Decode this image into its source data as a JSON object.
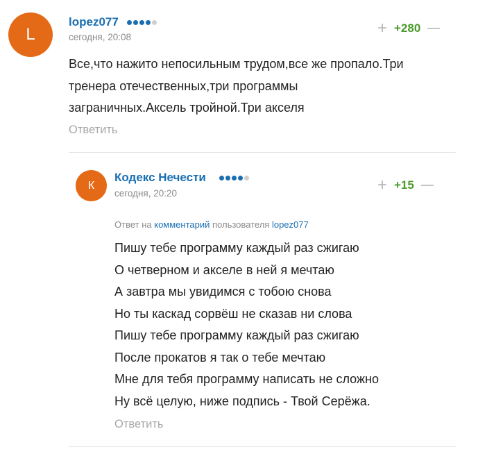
{
  "comments": [
    {
      "avatar_letter": "L",
      "username": "lopez077",
      "timestamp": "сегодня, 20:08",
      "vote": {
        "plus": "+",
        "score": "+280"
      },
      "text_lines": [
        "Все,что нажито непосильным трудом,все же пропало.Три",
        "тренера отечественных,три программы",
        "заграничных.Аксель тройной.Три акселя"
      ],
      "reply_label": "Ответить"
    },
    {
      "avatar_letter": "К",
      "username": "Кодекс Нечести",
      "timestamp": "сегодня, 20:20",
      "vote": {
        "plus": "+",
        "score": "+15"
      },
      "reply_to": {
        "prefix": "Ответ на",
        "link": "комментарий",
        "middle": "пользователя",
        "user": "lopez077"
      },
      "text_lines": [
        "Пишу тебе программу каждый раз сжигаю",
        "О четверном и акселе в ней я мечтаю",
        "А завтра мы увидимся с тобою снова",
        "Но ты каскад сорвёш не сказав ни слова",
        "Пишу тебе программу каждый раз сжигаю",
        "После прокатов я так о тебе мечтаю",
        "Мне для тебя программу написать не сложно",
        "Ну всё целую, ниже подпись - Твой Серёжа."
      ],
      "reply_label": "Ответить"
    }
  ],
  "colors": {
    "avatar": "#e56a18",
    "username": "#1a6fb1",
    "score_positive": "#4a9a2a",
    "muted": "#8a8a8a"
  },
  "rating_dots": {
    "filled": 4,
    "total": 5
  }
}
